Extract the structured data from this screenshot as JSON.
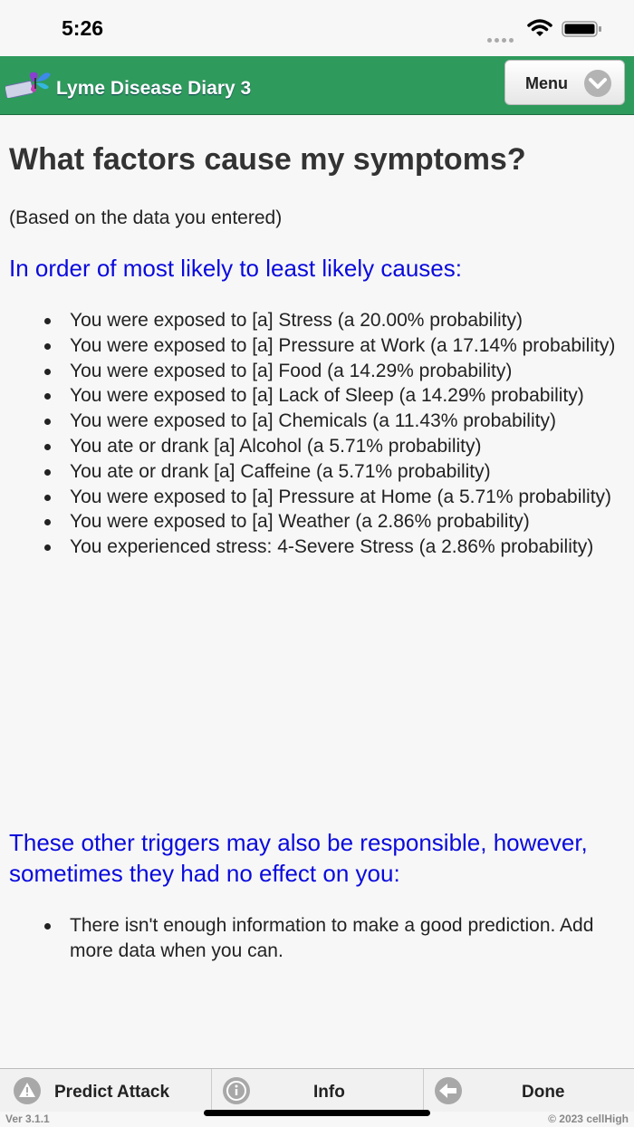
{
  "status": {
    "time": "5:26"
  },
  "header": {
    "title": "Lyme Disease Diary 3",
    "menu_label": "Menu"
  },
  "main": {
    "title": "What factors cause my symptoms?",
    "subtitle": "(Based on the data you entered)",
    "causes_heading": "In order of most likely to least likely causes:",
    "causes": [
      "You were exposed to [a] Stress (a 20.00% probability)",
      "You were exposed to [a] Pressure at Work (a 17.14% probability)",
      "You were exposed to [a] Food (a 14.29% probability)",
      "You were exposed to [a] Lack of Sleep (a 14.29% probability)",
      "You were exposed to [a] Chemicals (a 11.43% probability)",
      "You ate or drank [a] Alcohol (a 5.71% probability)",
      "You ate or drank [a] Caffeine (a 5.71% probability)",
      "You were exposed to [a] Pressure at Home (a 5.71% probability)",
      "You were exposed to [a] Weather (a 2.86% probability)",
      "You experienced stress: 4-Severe Stress (a 2.86% probability)"
    ],
    "other_heading": "These other triggers may also be responsible, however, sometimes they had no effect on you:",
    "other_items": [
      "There isn't enough information to make a good prediction. Add more data when you can."
    ]
  },
  "tabs": [
    {
      "label": "Predict Attack",
      "icon": "warning-icon"
    },
    {
      "label": "Info",
      "icon": "info-icon"
    },
    {
      "label": "Done",
      "icon": "back-arrow-icon"
    }
  ],
  "footer": {
    "version": "Ver 3.1.1",
    "copyright": "© 2023 cellHigh"
  },
  "colors": {
    "header_bg": "#2e9a5c",
    "heading_blue": "#0a0add"
  }
}
